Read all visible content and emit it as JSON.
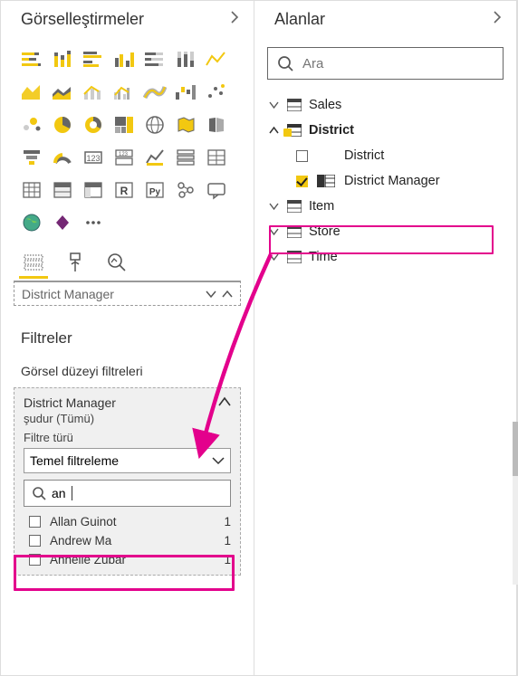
{
  "viz_panel": {
    "title": "Görselleştirmeler"
  },
  "fields_panel": {
    "title": "Alanlar",
    "search_placeholder": "Ara",
    "tables": [
      {
        "name": "Sales",
        "expanded": false
      },
      {
        "name": "District",
        "expanded": true,
        "fields": [
          {
            "name": "District",
            "checked": false,
            "kind": "text"
          },
          {
            "name": "District Manager",
            "checked": true,
            "kind": "column"
          }
        ]
      },
      {
        "name": "Item",
        "expanded": false
      },
      {
        "name": "Store",
        "expanded": false
      },
      {
        "name": "Time",
        "expanded": false
      }
    ]
  },
  "field_well": {
    "value": "District Manager"
  },
  "filters": {
    "title": "Filtreler",
    "level_label": "Görsel düzeyi filtreleri",
    "card": {
      "field_name": "District Manager",
      "summary": "şudur (Tümü)",
      "type_label": "Filtre türü",
      "type_value": "Temel filtreleme",
      "search_text": "an",
      "options": [
        {
          "label": "Allan Guinot",
          "count": "1"
        },
        {
          "label": "Andrew Ma",
          "count": "1"
        },
        {
          "label": "Annelie Zubar",
          "count": "1"
        }
      ]
    }
  },
  "viz_icons": [
    "stacked-bar",
    "stacked-column",
    "clustered-bar",
    "clustered-column",
    "100-bar",
    "100-column",
    "line",
    "area",
    "stacked-area",
    "line-stacked",
    "line-clustered",
    "ribbon",
    "waterfall",
    "scatter",
    "scatter2",
    "pie",
    "donut",
    "treemap",
    "table",
    "map",
    "filled-map",
    "funnel",
    "gauge",
    "card",
    "multi-card",
    "kpi",
    "slicer",
    "matrix",
    "matrix2",
    "table2",
    "matrix3",
    "r",
    "py",
    "key-influencers",
    "qa",
    "globe",
    "powerapps",
    "more"
  ]
}
